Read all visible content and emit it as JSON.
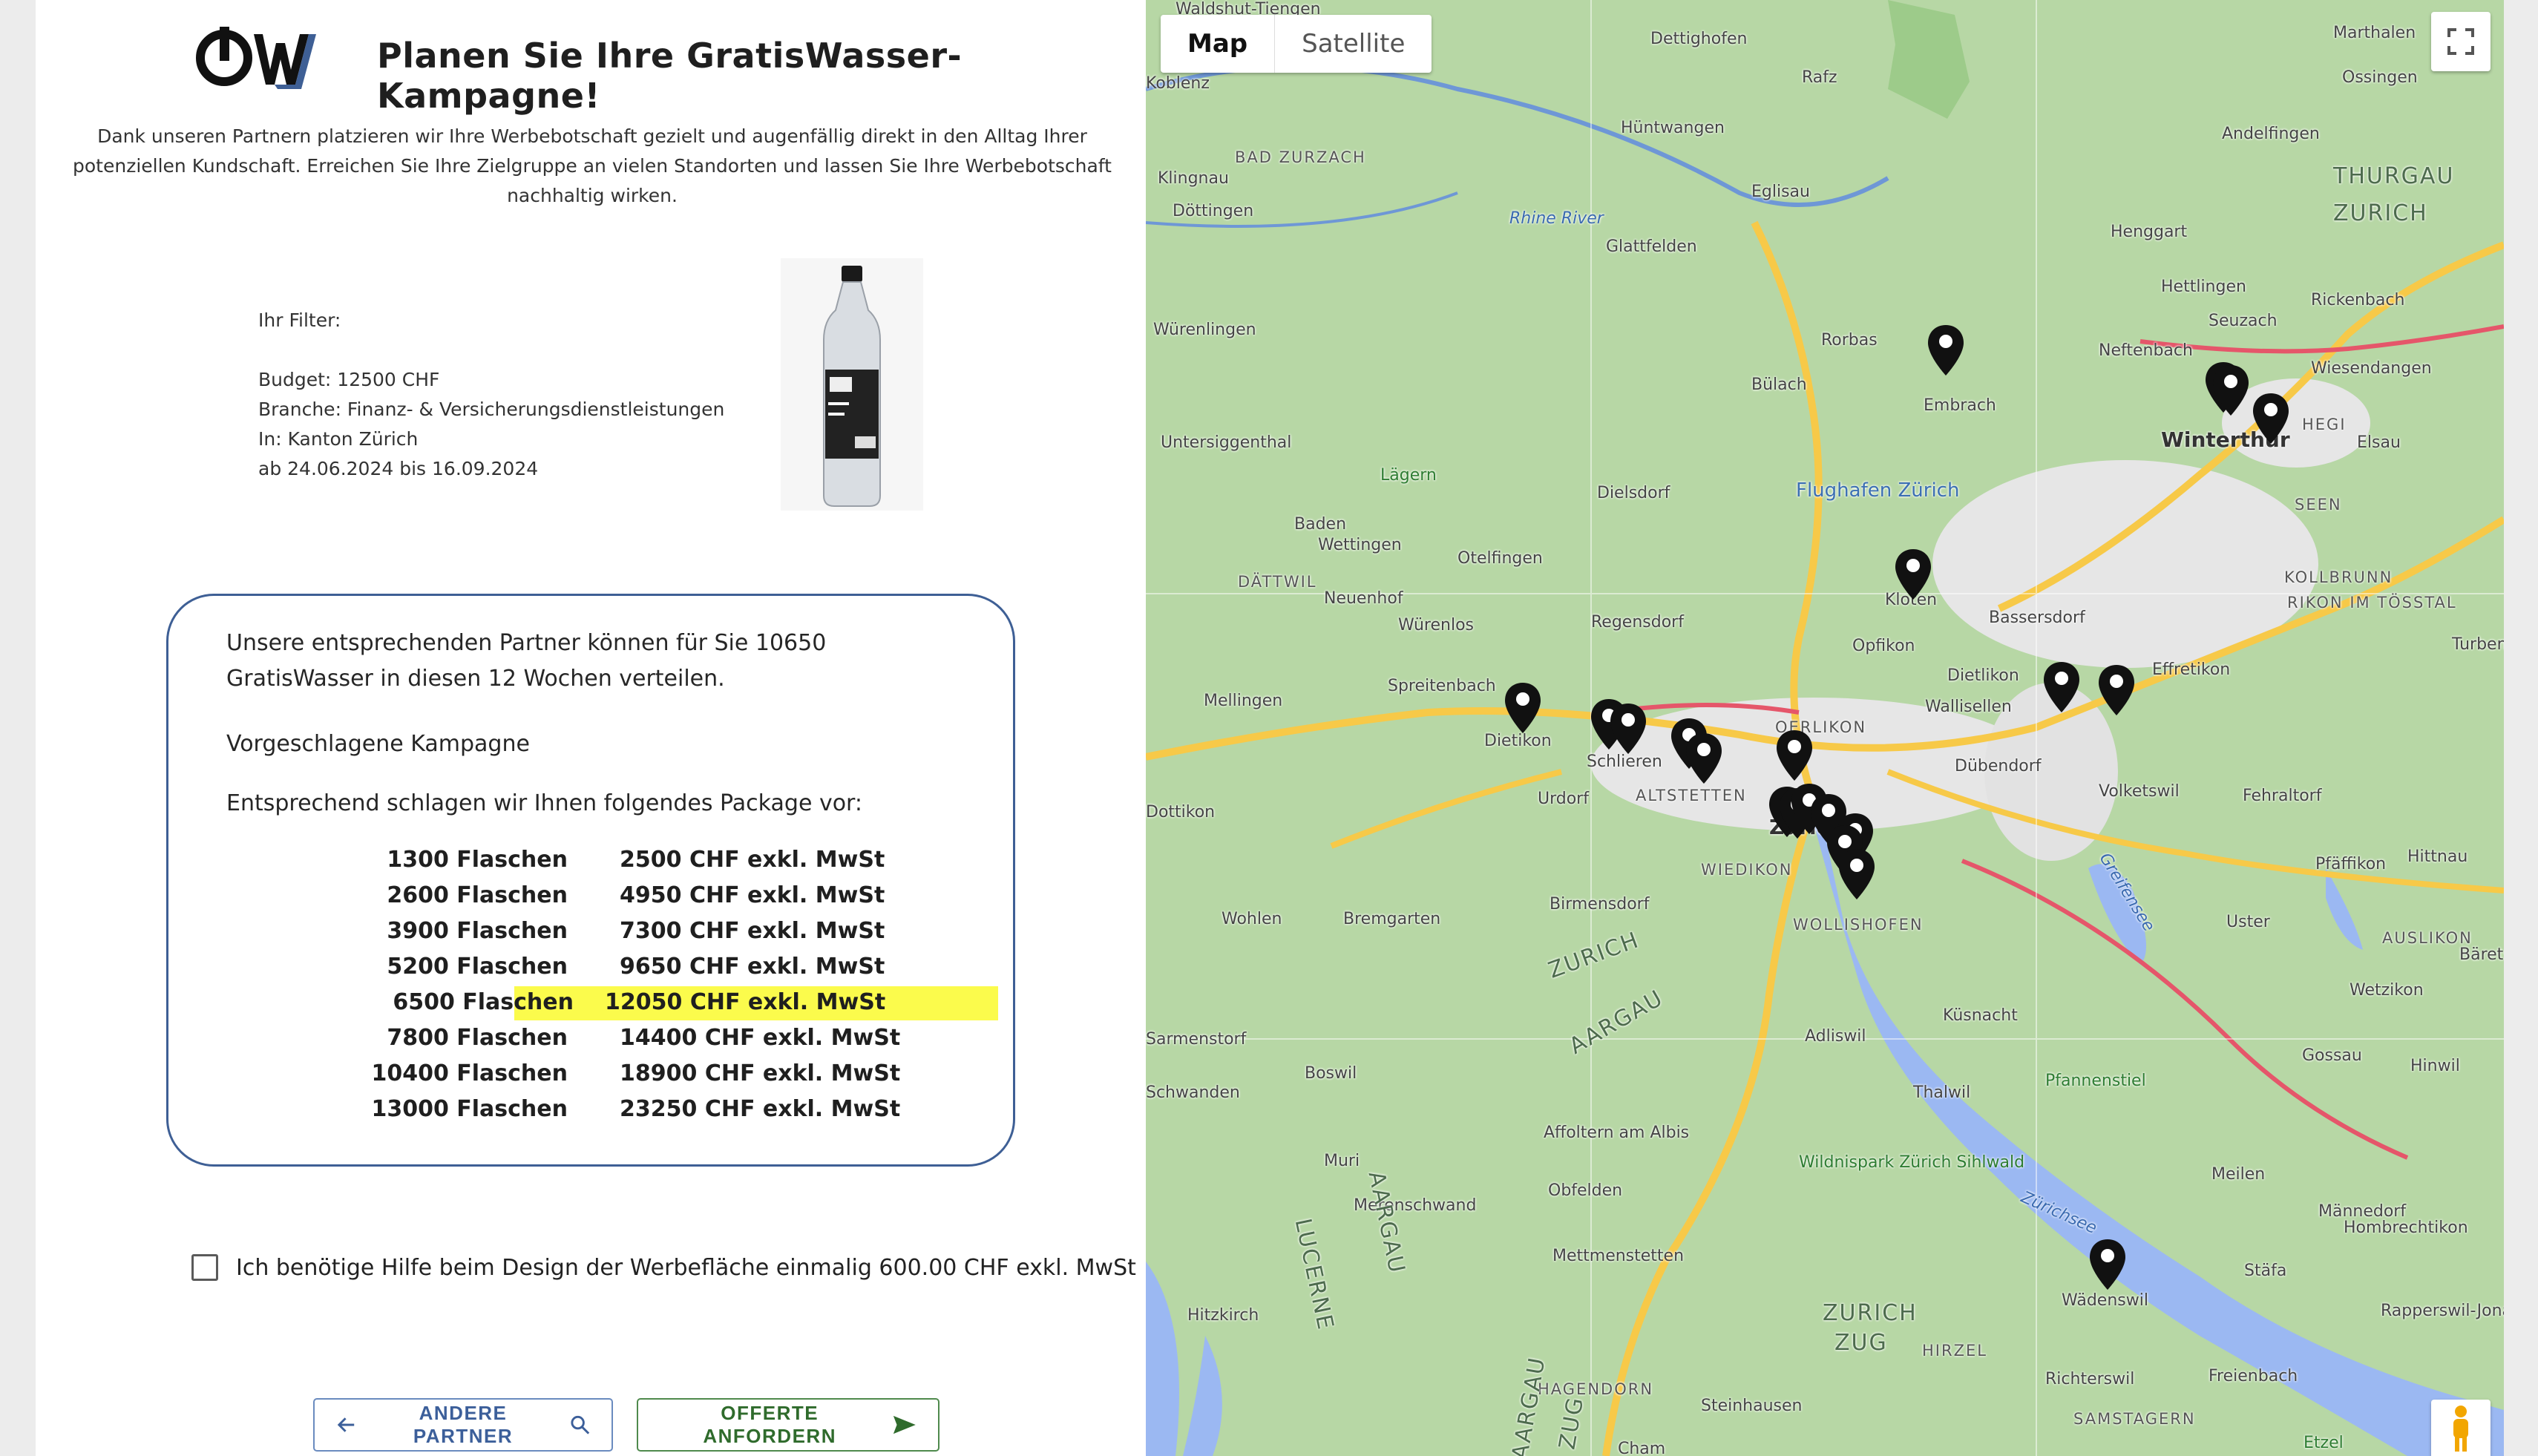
{
  "header": {
    "title": "Planen Sie Ihre GratisWasser-Kampagne!",
    "intro": "Dank unseren Partnern platzieren wir Ihre Werbebotschaft gezielt und augenfällig direkt in den Alltag Ihrer potenziellen Kundschaft. Erreichen Sie Ihre Zielgruppe an vielen Standorten und lassen Sie Ihre Werbebotschaft nachhaltig wirken."
  },
  "filter": {
    "label": "Ihr Filter:",
    "budget": "Budget: 12500 CHF",
    "branche": "Branche: Finanz- & Versicherungsdienstleistungen",
    "region": "In: Kanton Zürich",
    "period": "ab 24.06.2024 bis 16.09.2024"
  },
  "proposal": {
    "summary": "Unsere entsprechenden Partner können für Sie 10650 GratisWasser in diesen 12 Wochen verteilen.",
    "heading": "Vorgeschlagene Kampagne",
    "package_intro": "Entsprechend schlagen wir Ihnen folgendes Package vor:",
    "packages": [
      {
        "bottles": "1300 Flaschen",
        "price": "2500 CHF exkl. MwSt",
        "highlighted": false
      },
      {
        "bottles": "2600 Flaschen",
        "price": "4950 CHF exkl. MwSt",
        "highlighted": false
      },
      {
        "bottles": "3900 Flaschen",
        "price": "7300 CHF exkl. MwSt",
        "highlighted": false
      },
      {
        "bottles": "5200 Flaschen",
        "price": "9650 CHF exkl. MwSt",
        "highlighted": false
      },
      {
        "bottles": "6500 Flaschen",
        "price": "12050 CHF exkl. MwSt",
        "highlighted": true
      },
      {
        "bottles": "7800 Flaschen",
        "price": "14400 CHF exkl. MwSt",
        "highlighted": false
      },
      {
        "bottles": "10400 Flaschen",
        "price": "18900 CHF exkl. MwSt",
        "highlighted": false
      },
      {
        "bottles": "13000 Flaschen",
        "price": "23250 CHF exkl. MwSt",
        "highlighted": false
      }
    ],
    "highlight_color": "#fbfb4c"
  },
  "design_help": {
    "label": "Ich benötige Hilfe beim Design der Werbefläche einmalig 600.00 CHF exkl. MwSt",
    "checked": false
  },
  "buttons": {
    "back_label": "ANDERE PARTNER",
    "offer_label": "OFFERTE ANFORDERN"
  },
  "map": {
    "type_map": "Map",
    "type_satellite": "Satellite",
    "active_type": "Map",
    "places": [
      {
        "name": "Waldshut-Tiengen",
        "cls": ""
      },
      {
        "name": "Dettighofen",
        "cls": ""
      },
      {
        "name": "Marthalen",
        "cls": ""
      },
      {
        "name": "Rafz",
        "cls": ""
      },
      {
        "name": "Ossingen",
        "cls": ""
      },
      {
        "name": "Koblenz",
        "cls": ""
      },
      {
        "name": "Hüntwangen",
        "cls": ""
      },
      {
        "name": "Andelfingen",
        "cls": ""
      },
      {
        "name": "BAD ZURZACH",
        "cls": "dist"
      },
      {
        "name": "THURGAU",
        "cls": "region"
      },
      {
        "name": "Klingnau",
        "cls": ""
      },
      {
        "name": "Eglisau",
        "cls": ""
      },
      {
        "name": "ZURICH",
        "cls": "region"
      },
      {
        "name": "Döttingen",
        "cls": ""
      },
      {
        "name": "Rhine River",
        "cls": "water"
      },
      {
        "name": "Henggart",
        "cls": ""
      },
      {
        "name": "Glattfelden",
        "cls": ""
      },
      {
        "name": "Hettlingen",
        "cls": ""
      },
      {
        "name": "Würenlingen",
        "cls": ""
      },
      {
        "name": "Rorbas",
        "cls": ""
      },
      {
        "name": "Neftenbach",
        "cls": ""
      },
      {
        "name": "Seuzach",
        "cls": ""
      },
      {
        "name": "Rickenbach",
        "cls": ""
      },
      {
        "name": "Bülach",
        "cls": ""
      },
      {
        "name": "Embrach",
        "cls": ""
      },
      {
        "name": "Wiesendangen",
        "cls": ""
      },
      {
        "name": "Untersiggenthal",
        "cls": ""
      },
      {
        "name": "Winterthur",
        "cls": "big"
      },
      {
        "name": "HEGI",
        "cls": "dist"
      },
      {
        "name": "Elsau",
        "cls": ""
      },
      {
        "name": "Lägern",
        "cls": "green"
      },
      {
        "name": "Flughafen Zürich",
        "cls": "airport"
      },
      {
        "name": "Dielsdorf",
        "cls": ""
      },
      {
        "name": "SEEN",
        "cls": "dist"
      },
      {
        "name": "Baden",
        "cls": ""
      },
      {
        "name": "Wettingen",
        "cls": ""
      },
      {
        "name": "Otelfingen",
        "cls": ""
      },
      {
        "name": "DÄTTWIL",
        "cls": "dist"
      },
      {
        "name": "Kloten",
        "cls": ""
      },
      {
        "name": "KOLLBRUNN",
        "cls": "dist"
      },
      {
        "name": "Neuenhof",
        "cls": ""
      },
      {
        "name": "Regensdorf",
        "cls": ""
      },
      {
        "name": "Bassersdorf",
        "cls": ""
      },
      {
        "name": "RIKON IM TÖSSTAL",
        "cls": "dist"
      },
      {
        "name": "Würenlos",
        "cls": ""
      },
      {
        "name": "Opfikon",
        "cls": ""
      },
      {
        "name": "Dietlikon",
        "cls": ""
      },
      {
        "name": "Effretikon",
        "cls": ""
      },
      {
        "name": "Turbent",
        "cls": ""
      },
      {
        "name": "Spreitenbach",
        "cls": ""
      },
      {
        "name": "OERLIKON",
        "cls": "dist"
      },
      {
        "name": "Wallisellen",
        "cls": ""
      },
      {
        "name": "Mellingen",
        "cls": ""
      },
      {
        "name": "Dietikon",
        "cls": ""
      },
      {
        "name": "Schlieren",
        "cls": ""
      },
      {
        "name": "ALTSTETTEN",
        "cls": "dist"
      },
      {
        "name": "Dübendorf",
        "cls": ""
      },
      {
        "name": "Urdorf",
        "cls": ""
      },
      {
        "name": "Volketswil",
        "cls": ""
      },
      {
        "name": "Fehraltorf",
        "cls": ""
      },
      {
        "name": "Dottikon",
        "cls": ""
      },
      {
        "name": "Zürich",
        "cls": "big"
      },
      {
        "name": "WIEDIKON",
        "cls": "dist"
      },
      {
        "name": "Hittnau",
        "cls": ""
      },
      {
        "name": "Pfäffikon",
        "cls": ""
      },
      {
        "name": "Birmensdorf",
        "cls": ""
      },
      {
        "name": "WOLLISHOFEN",
        "cls": "dist"
      },
      {
        "name": "Greifensee",
        "cls": "water"
      },
      {
        "name": "Wohlen",
        "cls": ""
      },
      {
        "name": "Bremgarten",
        "cls": ""
      },
      {
        "name": "ZURICH",
        "cls": "region"
      },
      {
        "name": "Uster",
        "cls": ""
      },
      {
        "name": "Bäretsw",
        "cls": ""
      },
      {
        "name": "AUSLIKON",
        "cls": "dist"
      },
      {
        "name": "AARGAU",
        "cls": "region"
      },
      {
        "name": "Adliswil",
        "cls": ""
      },
      {
        "name": "Wetzikon",
        "cls": ""
      },
      {
        "name": "Küsnacht",
        "cls": ""
      },
      {
        "name": "Sarmenstorf",
        "cls": ""
      },
      {
        "name": "Gossau",
        "cls": ""
      },
      {
        "name": "Pfannenstiel",
        "cls": "green"
      },
      {
        "name": "Boswil",
        "cls": ""
      },
      {
        "name": "Hinwil",
        "cls": ""
      },
      {
        "name": "Thalwil",
        "cls": ""
      },
      {
        "name": "Schwanden",
        "cls": ""
      },
      {
        "name": "Affoltern am Albis",
        "cls": ""
      },
      {
        "name": "Muri",
        "cls": ""
      },
      {
        "name": "Wildnispark Zürich Sihlwald",
        "cls": "green"
      },
      {
        "name": "Meilen",
        "cls": ""
      },
      {
        "name": "Obfelden",
        "cls": ""
      },
      {
        "name": "Merenschwand",
        "cls": ""
      },
      {
        "name": "Männedorf",
        "cls": ""
      },
      {
        "name": "LUCERNE",
        "cls": "region"
      },
      {
        "name": "AARGAU",
        "cls": "region"
      },
      {
        "name": "Zürichsee",
        "cls": "water"
      },
      {
        "name": "Hombrechtikon",
        "cls": ""
      },
      {
        "name": "Mettmenstetten",
        "cls": ""
      },
      {
        "name": "Stäfa",
        "cls": ""
      },
      {
        "name": "Wädenswil",
        "cls": ""
      },
      {
        "name": "Rapperswil-Jona",
        "cls": ""
      },
      {
        "name": "Hitzkirch",
        "cls": ""
      },
      {
        "name": "ZURICH",
        "cls": "region"
      },
      {
        "name": "ZUG",
        "cls": "region"
      },
      {
        "name": "HIRZEL",
        "cls": "dist"
      },
      {
        "name": "Richterswil",
        "cls": ""
      },
      {
        "name": "Freienbach",
        "cls": ""
      },
      {
        "name": "HAGENDORN",
        "cls": "dist"
      },
      {
        "name": "AARGAU",
        "cls": "region"
      },
      {
        "name": "ZUG",
        "cls": "region"
      },
      {
        "name": "Steinhausen",
        "cls": ""
      },
      {
        "name": "SAMSTAGERN",
        "cls": "dist"
      },
      {
        "name": "Etzel",
        "cls": "green"
      },
      {
        "name": "Cham",
        "cls": ""
      }
    ],
    "colors": {
      "land": "#b7d7a5",
      "water": "#9bb8f2",
      "road_major": "#f7c948",
      "road_red": "#e5566a",
      "urban": "#e6e6e6",
      "forest": "#9dcb8a"
    }
  }
}
